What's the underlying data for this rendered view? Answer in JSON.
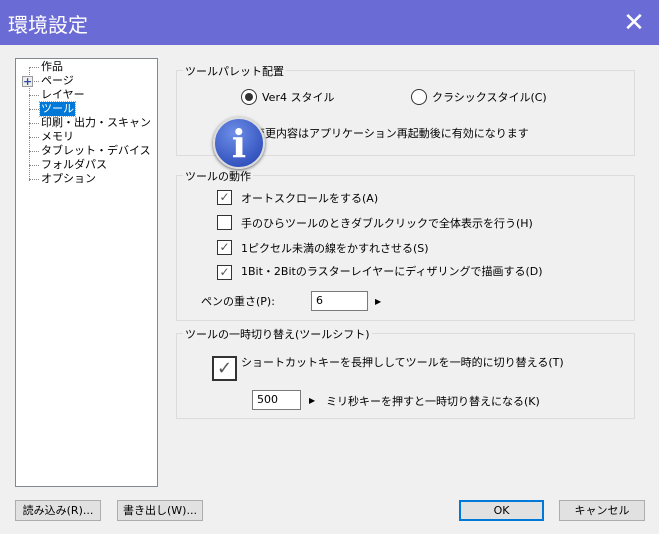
{
  "window": {
    "title": "環境設定",
    "close": "✕"
  },
  "tree": {
    "items": [
      {
        "label": "作品"
      },
      {
        "label": "ページ",
        "expandable": true
      },
      {
        "label": "レイヤー"
      },
      {
        "label": "ツール",
        "selected": true
      },
      {
        "label": "印刷・出力・スキャン"
      },
      {
        "label": "メモリ"
      },
      {
        "label": "タブレット・デバイス"
      },
      {
        "label": "フォルダパス"
      },
      {
        "label": "オプション"
      }
    ],
    "expand_symbol": "+"
  },
  "palette": {
    "title": "ツールパレット配置",
    "radio_ver4": "Ver4 スタイル",
    "radio_classic": "クラシックスタイル(C)",
    "selected": "ver4",
    "notice": "変更内容はアプリケーション再起動後に有効になります",
    "info_glyph": "i"
  },
  "behavior": {
    "title": "ツールの動作",
    "options": [
      {
        "label": "オートスクロールをする(A)",
        "checked": true
      },
      {
        "label": "手のひらツールのときダブルクリックで全体表示を行う(H)",
        "checked": false
      },
      {
        "label": "1ピクセル未満の線をかすれさせる(S)",
        "checked": true
      },
      {
        "label": "1Bit・2Bitのラスターレイヤーにディザリングで描画する(D)",
        "checked": true
      }
    ],
    "pen_weight_label": "ペンの重さ(P):",
    "pen_weight_value": "6"
  },
  "toolshift": {
    "title": "ツールの一時切り替え(ツールシフト)",
    "option": "ショートカットキーを長押ししてツールを一時的に切り替える(T)",
    "checked": true,
    "ms_value": "500",
    "ms_label": "ミリ秒キーを押すと一時切り替えになる(K)"
  },
  "buttons": {
    "load": "読み込み(R)...",
    "export": "書き出し(W)...",
    "ok": "OK",
    "cancel": "キャンセル"
  },
  "check_glyph": "✓",
  "arrow_glyph": "▶"
}
